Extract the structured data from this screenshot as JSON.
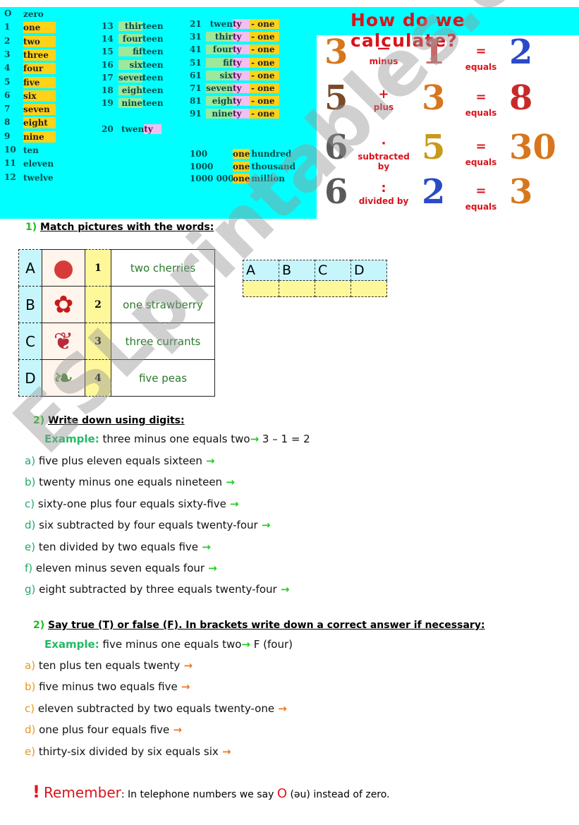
{
  "numbers": {
    "col1": [
      {
        "n": "O",
        "w": "zero"
      },
      {
        "n": "1",
        "w": "one"
      },
      {
        "n": "2",
        "w": "two"
      },
      {
        "n": "3",
        "w": "three"
      },
      {
        "n": "4",
        "w": "four"
      },
      {
        "n": "5",
        "w": "five"
      },
      {
        "n": "6",
        "w": "six"
      },
      {
        "n": "7",
        "w": "seven"
      },
      {
        "n": "8",
        "w": "eight"
      },
      {
        "n": "9",
        "w": "nine"
      },
      {
        "n": "10",
        "w": "ten"
      },
      {
        "n": "11",
        "w": "eleven"
      },
      {
        "n": "12",
        "w": "twelve"
      }
    ],
    "col2": [
      {
        "n": "13",
        "stem": "thir",
        "suffix": "teen"
      },
      {
        "n": "14",
        "stem": "four",
        "suffix": "teen"
      },
      {
        "n": "15",
        "stem": "fif",
        "suffix": "teen"
      },
      {
        "n": "16",
        "stem": "six",
        "suffix": "teen"
      },
      {
        "n": "17",
        "stem": "seven",
        "suffix": "teen"
      },
      {
        "n": "18",
        "stem": "eigh",
        "suffix": "teen"
      },
      {
        "n": "19",
        "stem": "nine",
        "suffix": "teen"
      }
    ],
    "twenty": {
      "n": "20",
      "stem": "twen",
      "suffix": "ty"
    },
    "col3": [
      {
        "n": "21",
        "stem": "twen",
        "mid": "ty",
        "end": "- one"
      },
      {
        "n": "31",
        "stem": "thir",
        "mid": "ty",
        "end": "- one"
      },
      {
        "n": "41",
        "stem": "four",
        "mid": "ty",
        "end": "- one"
      },
      {
        "n": "51",
        "stem": "fif",
        "mid": "ty",
        "end": "- one"
      },
      {
        "n": "61",
        "stem": "six",
        "mid": "ty",
        "end": "- one"
      },
      {
        "n": "71",
        "stem": "seven",
        "mid": "ty",
        "end": "- one"
      },
      {
        "n": "81",
        "stem": "eigh",
        "mid": "ty",
        "end": "- one"
      },
      {
        "n": "91",
        "stem": "nine",
        "mid": "ty",
        "end": "- one"
      }
    ],
    "big": [
      {
        "n": "100",
        "one": "one",
        "rest": "hundred"
      },
      {
        "n": "1000",
        "one": "one",
        "rest": "thousand"
      },
      {
        "n": "1000 000",
        "one": "one",
        "rest": "million"
      }
    ]
  },
  "calc": {
    "title": "How do we calculate?",
    "rows": [
      {
        "a": "3",
        "sym": "—",
        "op": "minus",
        "b": "1",
        "eq_sym": "=",
        "eq": "equals",
        "r": "2"
      },
      {
        "a": "5",
        "sym": "+",
        "op": "plus",
        "b": "3",
        "eq_sym": "=",
        "eq": "equals",
        "r": "8"
      },
      {
        "a": "6",
        "sym": "·",
        "op": "subtracted by",
        "b": "5",
        "eq_sym": "=",
        "eq": "equals",
        "r": "30"
      },
      {
        "a": "6",
        "sym": ":",
        "op": "divided by",
        "b": "2",
        "eq_sym": "=",
        "eq": "equals",
        "r": "3"
      }
    ]
  },
  "ex1": {
    "num": "1)",
    "title": "Match pictures with the words:",
    "rows": [
      {
        "letter": "A",
        "picture": "strawberry-image",
        "digit": "1",
        "word": "two cherries"
      },
      {
        "letter": "B",
        "picture": "currants-image",
        "digit": "2",
        "word": "one strawberry"
      },
      {
        "letter": "C",
        "picture": "cherries-image",
        "digit": "3",
        "word": "three currants"
      },
      {
        "letter": "D",
        "picture": "peas-image",
        "digit": "4",
        "word": "five peas"
      }
    ],
    "answer_letters": [
      "A",
      "B",
      "C",
      "D"
    ]
  },
  "ex2": {
    "num": "2)",
    "title": "Write down using digits:",
    "example_label": "Example:",
    "example_text": "three minus one equals two",
    "example_answer": "3 – 1 = 2",
    "arrow": "→",
    "items": [
      {
        "l": "a)",
        "t": "five plus eleven equals sixteen"
      },
      {
        "l": "b)",
        "t": "twenty minus one equals nineteen"
      },
      {
        "l": "c)",
        "t": "sixty-one plus four equals sixty-five"
      },
      {
        "l": "d)",
        "t": "six subtracted by four equals twenty-four"
      },
      {
        "l": "e)",
        "t": "ten divided by two equals five"
      },
      {
        "l": "f)",
        "t": "eleven minus seven equals four"
      },
      {
        "l": "g)",
        "t": "eight subtracted by three equals twenty-four"
      }
    ]
  },
  "ex3": {
    "num": "2)",
    "title": "Say true (T) or false (F). In brackets write down a correct answer if necessary:",
    "example_label": "Example:",
    "example_text": "five minus one equals two",
    "example_answer": "F (four)",
    "arrow": "→",
    "items": [
      {
        "l": "a)",
        "t": "ten plus ten equals twenty"
      },
      {
        "l": "b)",
        "t": "five minus two equals five"
      },
      {
        "l": "c)",
        "t": "eleven subtracted by two equals twenty-one"
      },
      {
        "l": "d)",
        "t": "one plus four equals five"
      },
      {
        "l": "e)",
        "t": "thirty-six divided by six equals six"
      }
    ]
  },
  "remember": {
    "bang": "!",
    "label": "Remember",
    "text1": ": In telephone numbers we say ",
    "zero": "O",
    "text2": " (əu) instead of zero."
  },
  "watermark": "ESLprintables.com"
}
